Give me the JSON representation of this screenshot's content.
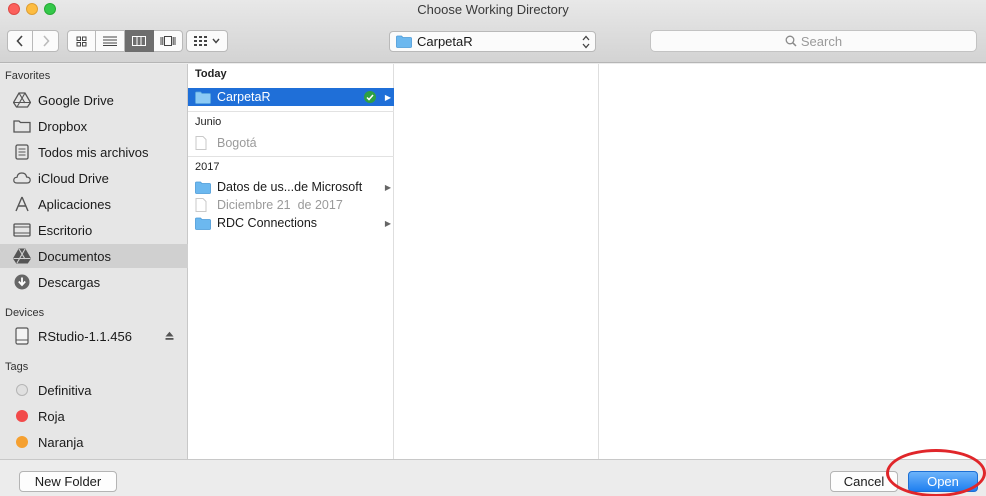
{
  "window": {
    "title": "Choose Working Directory",
    "traffic_colors": {
      "close": "#fc605c",
      "minimize": "#fdbc40",
      "zoom": "#34c84a"
    }
  },
  "toolbar": {
    "back_icon": "chevron-left-icon",
    "forward_icon": "chevron-right-icon",
    "view_modes": [
      "icon-view-icon",
      "list-view-icon",
      "column-view-icon",
      "cover-flow-icon"
    ],
    "active_view": "column-view-icon",
    "arrange_icon": "arrange-grid-icon",
    "path_label": "CarpetaR",
    "search_placeholder": "Search"
  },
  "sidebar": {
    "favorites_header": "Favorites",
    "favorites": [
      {
        "label": "Google Drive",
        "icon": "google-drive-icon"
      },
      {
        "label": "Dropbox",
        "icon": "folder-icon"
      },
      {
        "label": "Todos mis archivos",
        "icon": "all-files-icon"
      },
      {
        "label": "iCloud Drive",
        "icon": "cloud-icon"
      },
      {
        "label": "Aplicaciones",
        "icon": "applications-icon"
      },
      {
        "label": "Escritorio",
        "icon": "desktop-icon"
      },
      {
        "label": "Documentos",
        "icon": "google-drive-icon",
        "selected": true
      },
      {
        "label": "Descargas",
        "icon": "download-icon"
      }
    ],
    "devices_header": "Devices",
    "devices": [
      {
        "label": "RStudio-1.1.456",
        "icon": "disk-icon",
        "eject": "eject-icon"
      }
    ],
    "tags_header": "Tags",
    "tags": [
      {
        "label": "Definitiva",
        "color": "#e0e0e0"
      },
      {
        "label": "Roja",
        "color": "#f24a4a"
      },
      {
        "label": "Naranja",
        "color": "#f5a030"
      }
    ]
  },
  "column1": {
    "group_today": "Today",
    "today_items": [
      {
        "label": "CarpetaR",
        "type": "folder",
        "selected": true,
        "has_children": true,
        "status_icon": "check-icon"
      }
    ],
    "group_junio": "Junio",
    "junio_items": [
      {
        "label": "Bogotá",
        "type": "file",
        "dim": true
      }
    ],
    "group_2017": "2017",
    "items_2017": [
      {
        "label": "Datos de us...de Microsoft",
        "type": "folder",
        "has_children": true
      },
      {
        "label": "Diciembre 21  de 2017",
        "type": "file",
        "dim": true
      },
      {
        "label": "RDC Connections",
        "type": "folder",
        "has_children": true
      }
    ]
  },
  "footer": {
    "new_folder_label": "New Folder",
    "cancel_label": "Cancel",
    "open_label": "Open",
    "annotation_color": "#e0262a"
  }
}
